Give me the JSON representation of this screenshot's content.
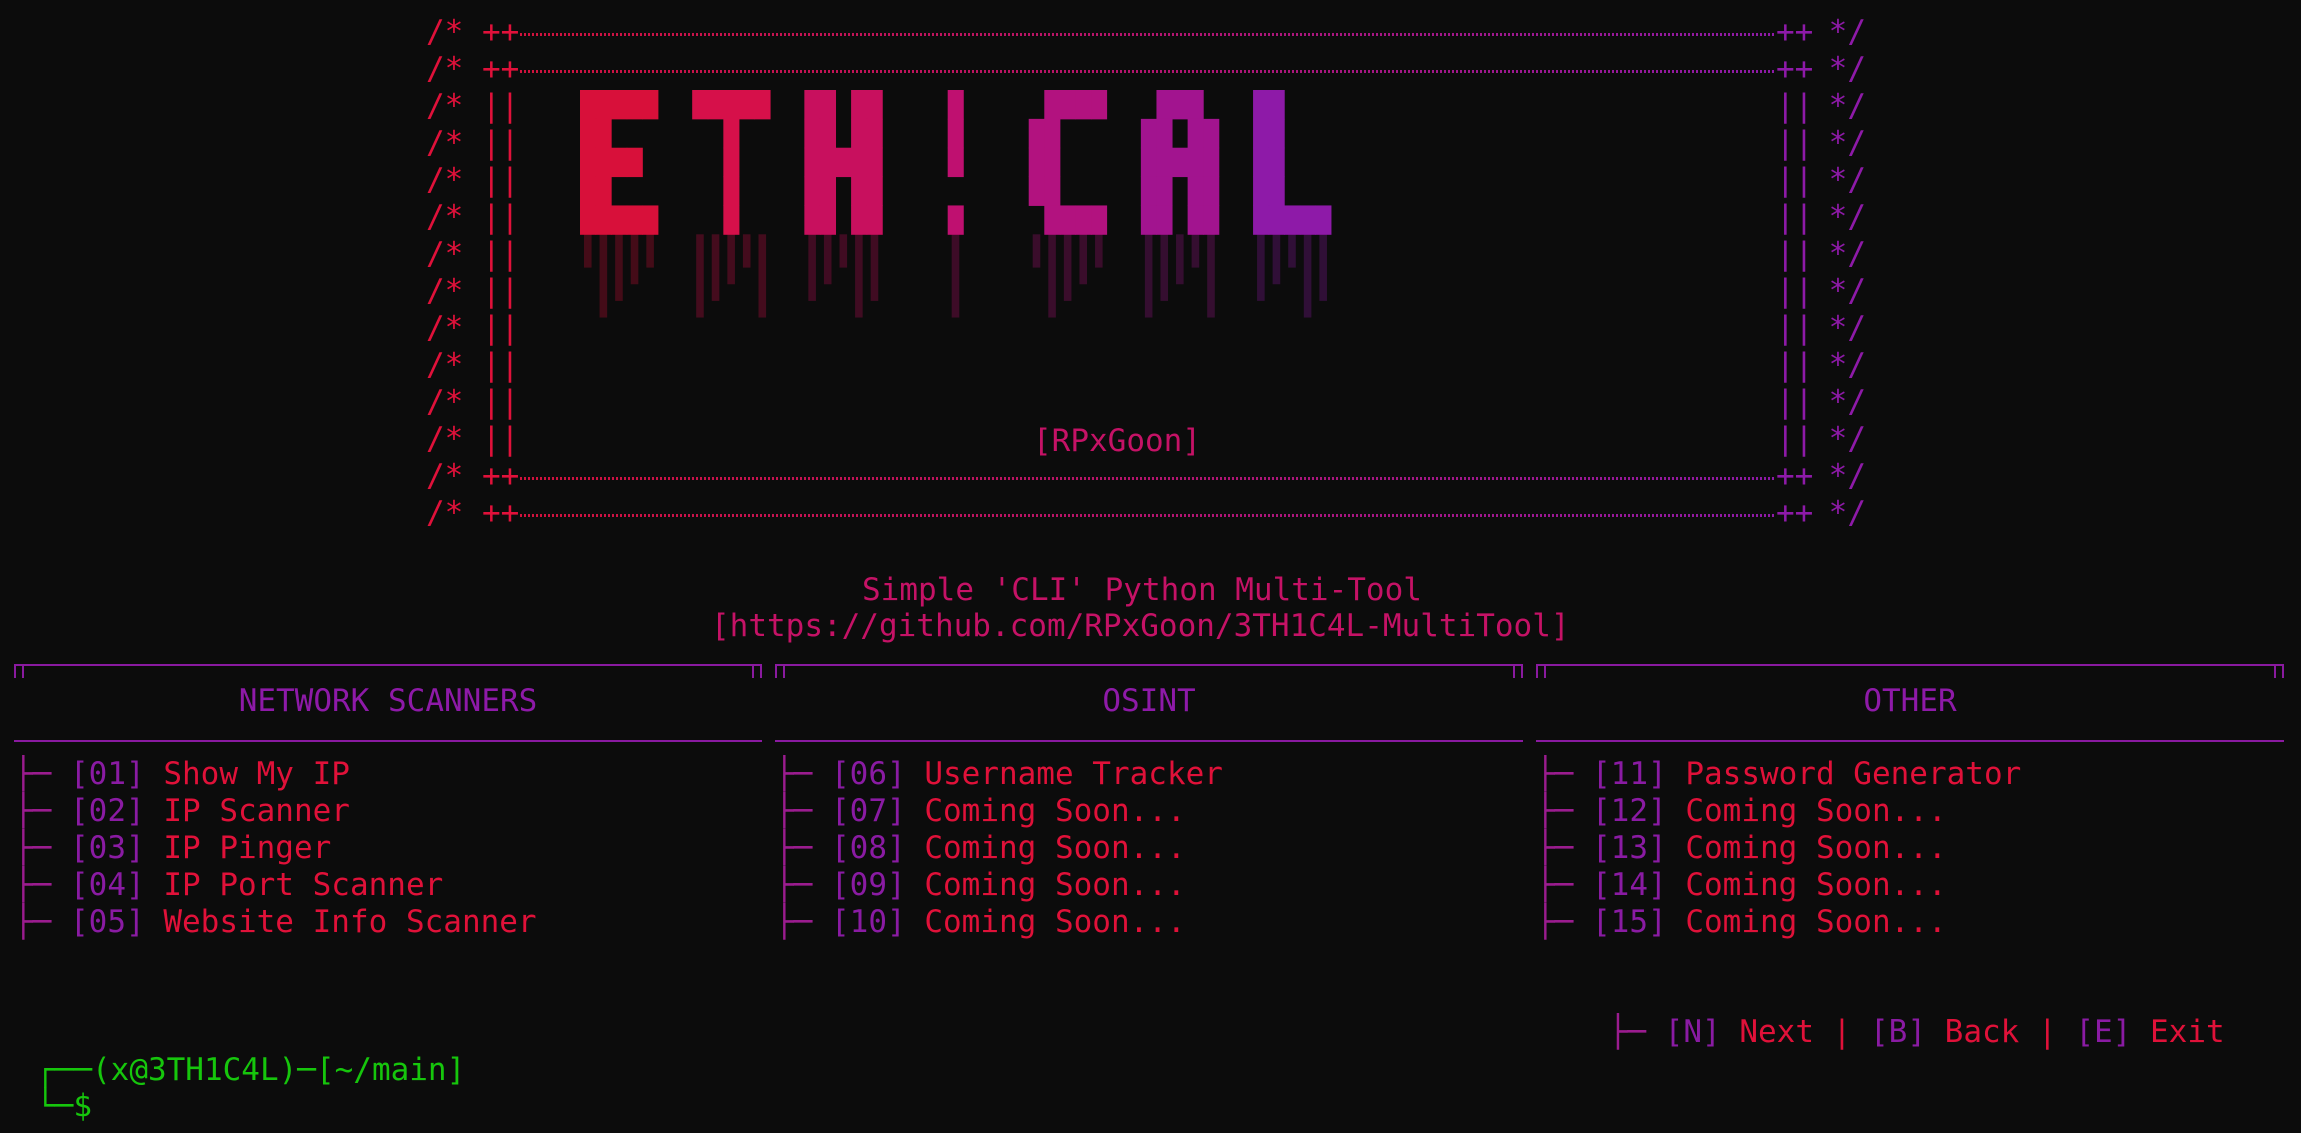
{
  "banner": {
    "comment_open": "/* ",
    "comment_close": " */",
    "border_left": "++",
    "border_right": "++",
    "side_bar": "||",
    "author_tag": "[RPxGoon]",
    "logo_text": "ETHICAL"
  },
  "subtitle": {
    "line1": "Simple 'CLI' Python Multi-Tool",
    "line2": "[https://github.com/RPxGoon/3TH1C4L-MultiTool]"
  },
  "sections": [
    {
      "title": "NETWORK SCANNERS",
      "items": [
        {
          "num": "[01]",
          "label": "Show My IP"
        },
        {
          "num": "[02]",
          "label": "IP Scanner"
        },
        {
          "num": "[03]",
          "label": "IP Pinger"
        },
        {
          "num": "[04]",
          "label": "IP Port Scanner"
        },
        {
          "num": "[05]",
          "label": "Website Info Scanner"
        }
      ]
    },
    {
      "title": "OSINT",
      "items": [
        {
          "num": "[06]",
          "label": "Username Tracker"
        },
        {
          "num": "[07]",
          "label": "Coming Soon..."
        },
        {
          "num": "[08]",
          "label": "Coming Soon..."
        },
        {
          "num": "[09]",
          "label": "Coming Soon..."
        },
        {
          "num": "[10]",
          "label": "Coming Soon..."
        }
      ]
    },
    {
      "title": "OTHER",
      "items": [
        {
          "num": "[11]",
          "label": "Password Generator"
        },
        {
          "num": "[12]",
          "label": "Coming Soon..."
        },
        {
          "num": "[13]",
          "label": "Coming Soon..."
        },
        {
          "num": "[14]",
          "label": "Coming Soon..."
        },
        {
          "num": "[15]",
          "label": "Coming Soon..."
        }
      ]
    }
  ],
  "tree_branch": "├─ ",
  "nav": {
    "next_key": "[N]",
    "next_label": "Next",
    "back_key": "[B]",
    "back_label": "Back",
    "exit_key": "[E]",
    "exit_label": "Exit",
    "separator": "|"
  },
  "prompt": {
    "top_line": "┌──(x@3TH1C4L)─[~/main]",
    "bottom_line": "└─$"
  },
  "colors": {
    "background": "#0c0c0c",
    "red": "#e0113a",
    "magenta": "#c51266",
    "purple": "#8e1aa8",
    "green": "#16c60c"
  }
}
